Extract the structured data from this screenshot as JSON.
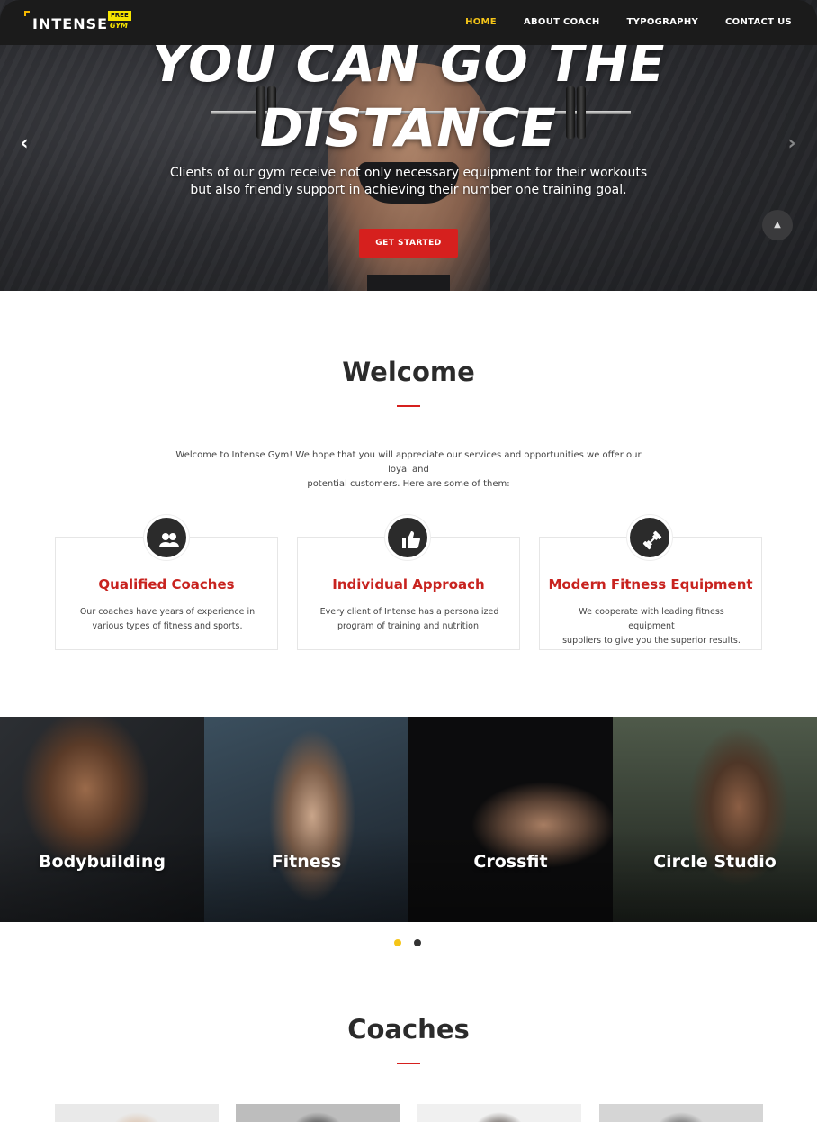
{
  "header": {
    "logo_text": "INTENSE",
    "logo_badge": "FREE",
    "logo_sub": "GYM",
    "nav": [
      {
        "label": "HOME",
        "active": true
      },
      {
        "label": "ABOUT COACH",
        "active": false
      },
      {
        "label": "TYPOGRAPHY",
        "active": false
      },
      {
        "label": "CONTACT US",
        "active": false
      }
    ]
  },
  "hero": {
    "title_line1": "YOU CAN GO THE",
    "title_line2": "DISTANCE",
    "subtitle_line1": "Clients of our gym receive not only necessary equipment for their workouts",
    "subtitle_line2": "but also friendly support in achieving their number one training goal.",
    "button": "GET STARTED",
    "prev_icon": "chevron-left-icon",
    "next_icon": "chevron-right-icon",
    "top_icon": "chevron-up-icon"
  },
  "welcome": {
    "title": "Welcome",
    "text_line1": "Welcome to Intense Gym! We hope that you will appreciate our services and opportunities we offer our loyal and",
    "text_line2": "potential customers. Here are some of them:"
  },
  "features": [
    {
      "icon": "people-icon",
      "title": "Qualified Coaches",
      "line1": "Our coaches have years of experience in",
      "line2": "various types of fitness and sports."
    },
    {
      "icon": "thumbs-up-icon",
      "title": "Individual Approach",
      "line1": "Every client of Intense has a personalized",
      "line2": "program of training and nutrition."
    },
    {
      "icon": "dumbbell-icon",
      "title": "Modern Fitness Equipment",
      "line1": "We cooperate with leading fitness equipment",
      "line2": "suppliers to give you the superior results."
    }
  ],
  "classes": [
    "Bodybuilding",
    "Fitness",
    "Crossfit",
    "Circle Studio"
  ],
  "carousel_dots": {
    "count": 2,
    "active": 1
  },
  "coaches": {
    "title": "Coaches"
  },
  "colors": {
    "accent_red": "#d6201e",
    "accent_yellow": "#f5c518",
    "header_bg": "#1b1b1b",
    "title_red": "#c8231f"
  }
}
